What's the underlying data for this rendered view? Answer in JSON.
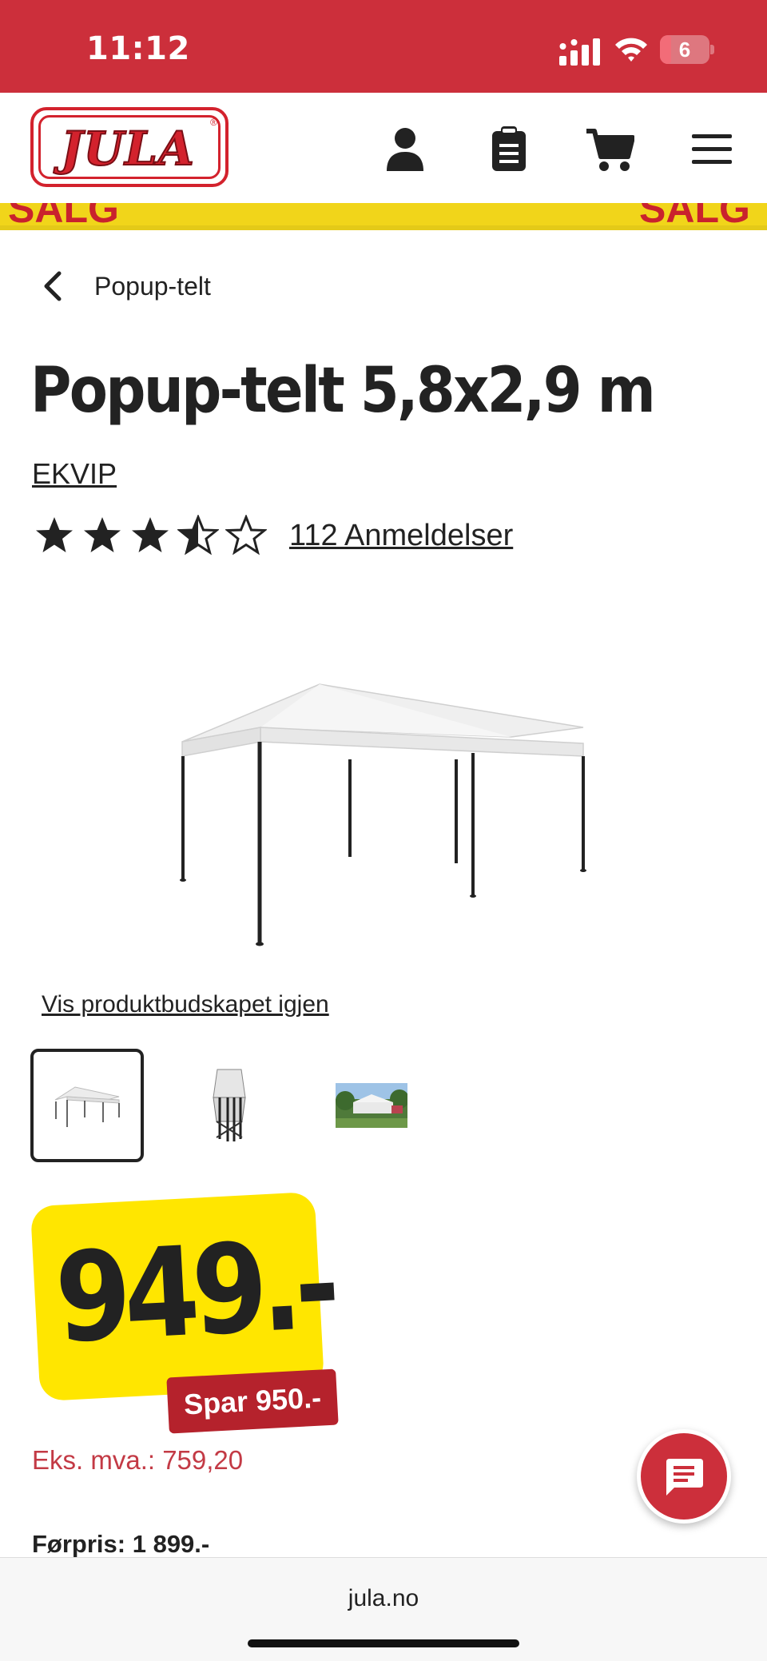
{
  "status_bar": {
    "time": "11:12",
    "battery_level": "6"
  },
  "header": {
    "logo_text": "JULA",
    "icons": [
      "user-icon",
      "clipboard-icon",
      "cart-icon",
      "menu-icon"
    ]
  },
  "banner": {
    "left_text": "SALG",
    "right_text": "SALG",
    "color": "#f1d51a"
  },
  "breadcrumb": {
    "label": "Popup-telt"
  },
  "product": {
    "title": "Popup-telt 5,8x2,9 m",
    "brand": "EKVIP",
    "rating": 3.5,
    "rating_max": 5,
    "reviews_label": "112 Anmeldelser",
    "show_message_link": "Vis produktbudskapet igjen",
    "thumbnails": [
      "tent-thumbnail",
      "folded-tent-thumbnail",
      "tent-in-garden-thumbnail"
    ]
  },
  "pricing": {
    "price": "949.-",
    "save_label": "Spar 950.-",
    "ex_vat": "Eks. mva.: 759,20",
    "previous_price": "Førpris: 1 899.-"
  },
  "browser": {
    "url": "jula.no"
  },
  "colors": {
    "brand_red": "#cc2f3b",
    "price_yellow": "#ffe600",
    "save_red": "#b5222c"
  }
}
